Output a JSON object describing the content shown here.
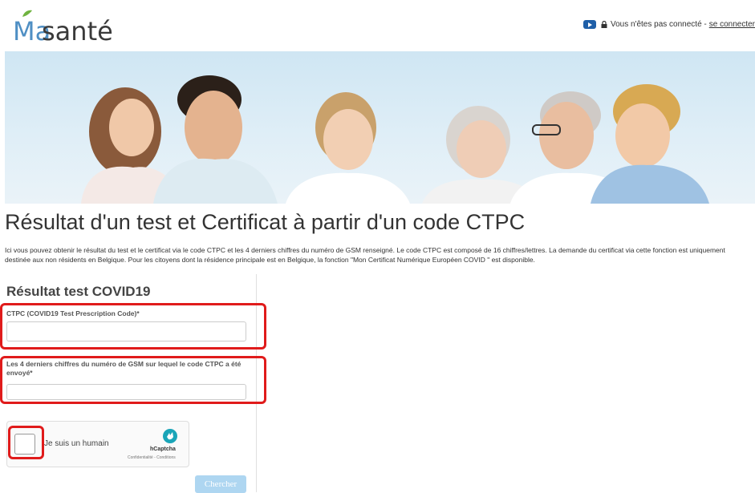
{
  "header": {
    "logo_prefix": "Ma",
    "logo_suffix": "santé",
    "status_text": "Vous n'êtes pas connecté -",
    "login_link": "se connecter"
  },
  "page": {
    "title": "Résultat d'un test et Certificat à partir d'un code CTPC",
    "intro": "Ici vous pouvez obtenir le résultat du test et le certificat via le code CTPC et les 4 derniers chiffres du numéro de GSM renseigné. Le code CTPC est composé de 16 chiffres/lettres. La demande du certificat via cette fonction est uniquement destinée aux non résidents en Belgique. Pour les citoyens dont la résidence principale est en Belgique, la fonction \"Mon Certificat Numérique Européen COVID \" est disponible."
  },
  "form": {
    "title": "Résultat test COVID19",
    "ctpc_label": "CTPC (COVID19 Test Prescription Code)*",
    "ctpc_value": "",
    "gsm_label": "Les 4 derniers chiffres du numéro de GSM sur lequel le code CTPC a été envoyé*",
    "gsm_value": "",
    "captcha_label": "Je suis un humain",
    "captcha_brand": "hCaptcha",
    "captcha_links": "Confidentialité - Conditions",
    "submit_label": "Chercher"
  },
  "colors": {
    "brand_blue": "#4f8fc4",
    "highlight_red": "#e01b1b",
    "button_disabled": "#aed6f1"
  }
}
